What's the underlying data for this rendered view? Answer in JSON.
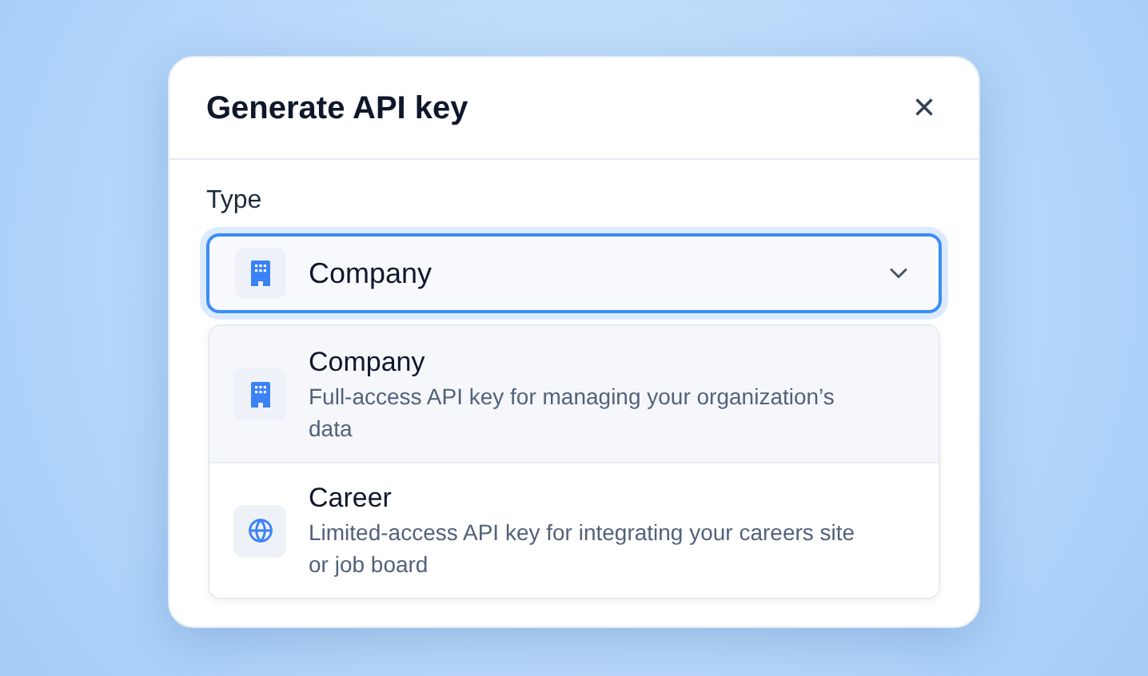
{
  "dialog": {
    "title": "Generate API key",
    "close": "×"
  },
  "field": {
    "label": "Type",
    "value": "Company",
    "kind": "company",
    "open": true
  },
  "options": [
    {
      "kind": "company",
      "label": "Company",
      "description": "Full-access API key for managing your organization’s data",
      "selected": true
    },
    {
      "kind": "career",
      "label": "Career",
      "description": "Limited-access API key for integrating your careers site or job board",
      "selected": false
    }
  ]
}
